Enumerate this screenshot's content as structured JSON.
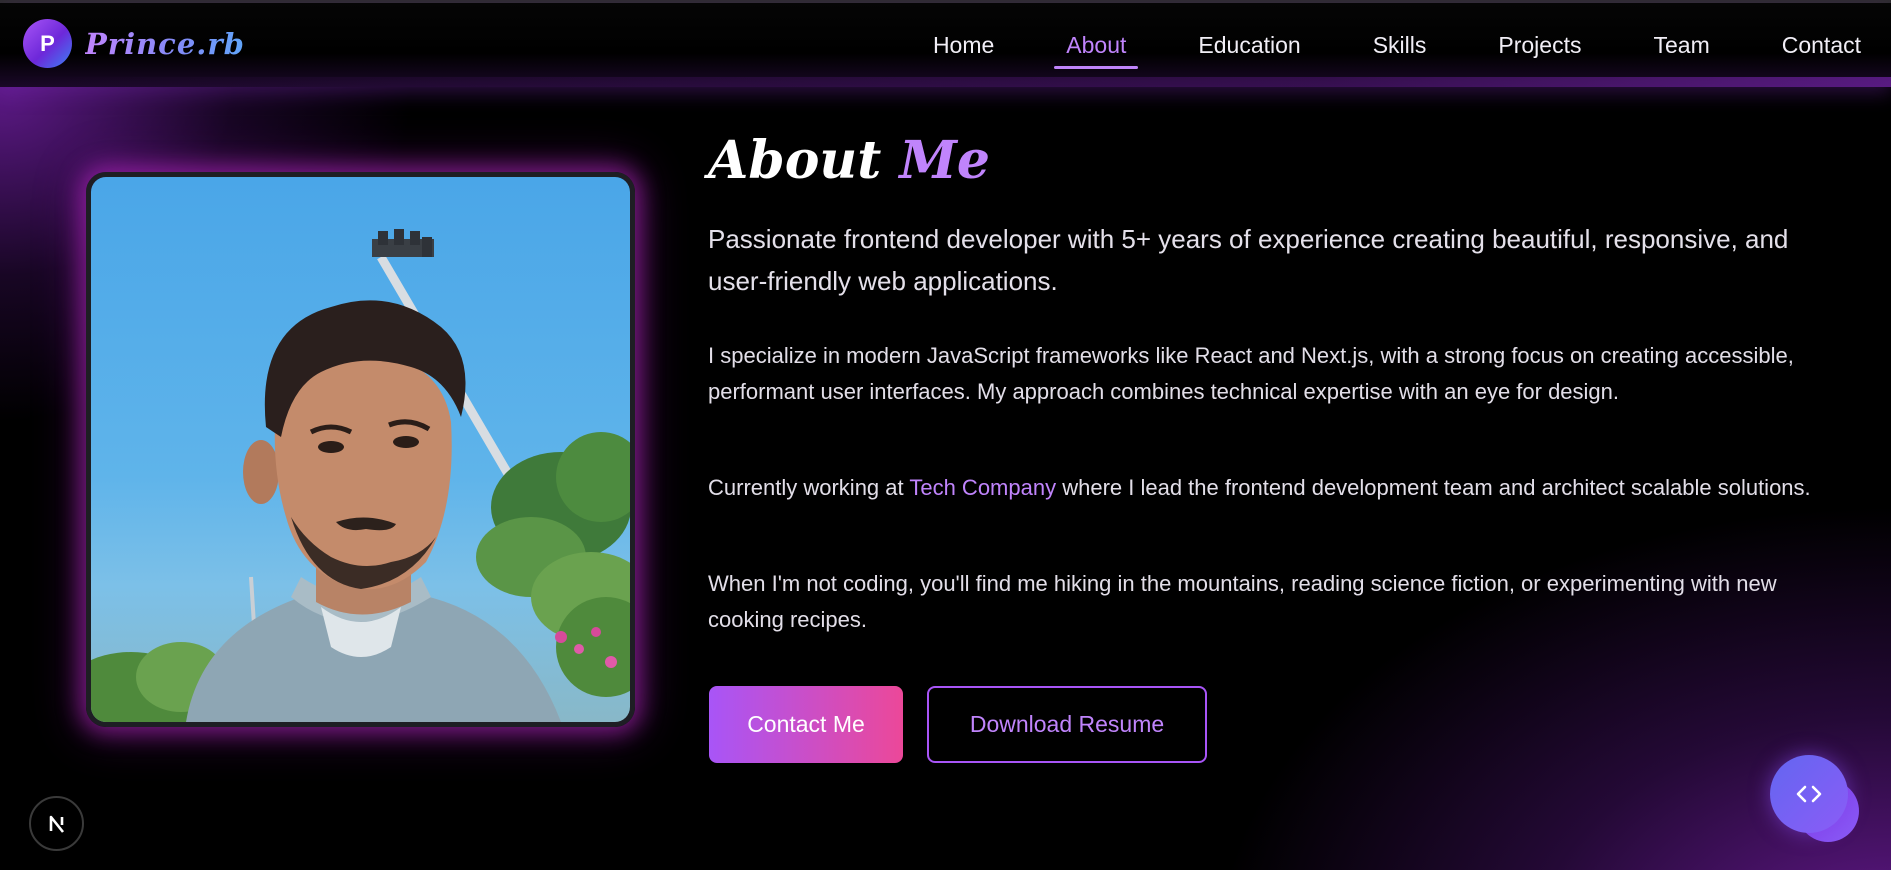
{
  "brand": {
    "initial": "P",
    "name": "Prince.rb"
  },
  "nav": {
    "items": [
      {
        "label": "Home"
      },
      {
        "label": "About"
      },
      {
        "label": "Education"
      },
      {
        "label": "Skills"
      },
      {
        "label": "Projects"
      },
      {
        "label": "Team"
      },
      {
        "label": "Contact"
      }
    ],
    "active": "About"
  },
  "about": {
    "title_main": "About",
    "title_accent": "Me",
    "lead": "Passionate frontend developer with 5+ years of experience creating beautiful, responsive, and user-friendly web applications.",
    "para1": "I specialize in modern JavaScript frameworks like React and Next.js, with a strong focus on creating accessible, performant user interfaces. My approach combines technical expertise with an eye for design.",
    "para2_before": "Currently working at ",
    "para2_company": "Tech Company",
    "para2_after": " where I lead the frontend development team and architect scalable solutions.",
    "para3": "When I'm not coding, you'll find me hiking in the mountains, reading science fiction, or experimenting with new cooking recipes."
  },
  "buttons": {
    "contact": "Contact Me",
    "resume": "Download Resume"
  },
  "floating": {
    "next_badge": "N",
    "code_fab": "< >"
  },
  "colors": {
    "accent": "#c084fc",
    "gradient_start": "#a855f7",
    "gradient_end": "#ec4899",
    "background": "#000000"
  },
  "icons": {
    "brand": "logo-badge",
    "photo": "profile-photo",
    "fab": "code-icon",
    "dev": "nextjs-icon"
  }
}
